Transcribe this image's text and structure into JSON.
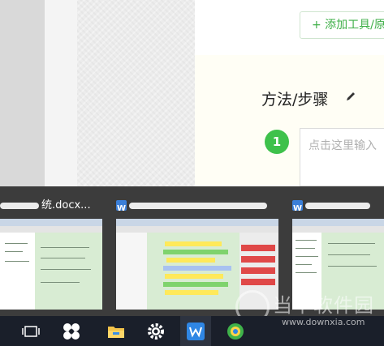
{
  "page": {
    "add_tool_button": "+ 添加工具/原",
    "method_heading": "方法/步骤",
    "step_number": "1",
    "step_placeholder": "点击这里输入"
  },
  "task_previews": [
    {
      "title": "统.docx..."
    },
    {
      "title": ""
    },
    {
      "title": ""
    }
  ],
  "taskbar": {
    "icons": [
      "task-view-icon",
      "fan-app-icon",
      "file-explorer-icon",
      "settings-icon",
      "wps-writer-icon",
      "green-browser-icon"
    ]
  },
  "watermark": {
    "name": "当下软件园",
    "url": "www.downxia.com"
  },
  "colors": {
    "accent_green": "#3ec14b",
    "taskbar_bg": "#1a1f2a",
    "wps_blue": "#3a7fd9"
  }
}
